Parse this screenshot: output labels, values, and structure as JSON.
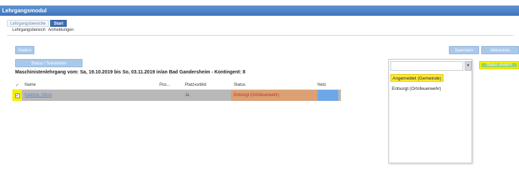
{
  "window": {
    "title": "Lehrgangsmodul"
  },
  "tabs": [
    {
      "label": "Lehrgangsbereiche"
    },
    {
      "label": "Start"
    }
  ],
  "subnav": [
    "Lehrgangsbereich",
    "Anmeldungen"
  ],
  "toolbar": {
    "top_left_button": "Ändern",
    "second_button": "Status / Teilnehmer",
    "right_button_1": "Speichern",
    "right_button_2": "Abbrechen",
    "green_button": "Status ändern"
  },
  "section_title": "Maschinistenlehrgang vom: Sa, 19.10.2019 bis So, 03.11.2019 in/an Bad Gandersheim - Kontingent: 8",
  "table": {
    "headers": [
      "Name",
      "Pos...",
      "Platzvorbild",
      "Status",
      "Netz"
    ],
    "rows": [
      {
        "checked": true,
        "name": "Kalidow, Oliver",
        "pos": "",
        "platz": "Ja",
        "status": "Entsorgt (Ortsfeuerwehr)",
        "netz": ""
      }
    ]
  },
  "dropdown": {
    "input_value": "",
    "options": [
      {
        "label": "Angemeldet (Gemeinde)",
        "selected": true
      },
      {
        "label": "Entsorgt (Ortsfeuerwehr)",
        "selected": false
      }
    ]
  },
  "colors": {
    "titlebar": "#3f74bd",
    "highlight": "#f4f000",
    "status": "#dba074",
    "button": "#a9c8ea"
  }
}
